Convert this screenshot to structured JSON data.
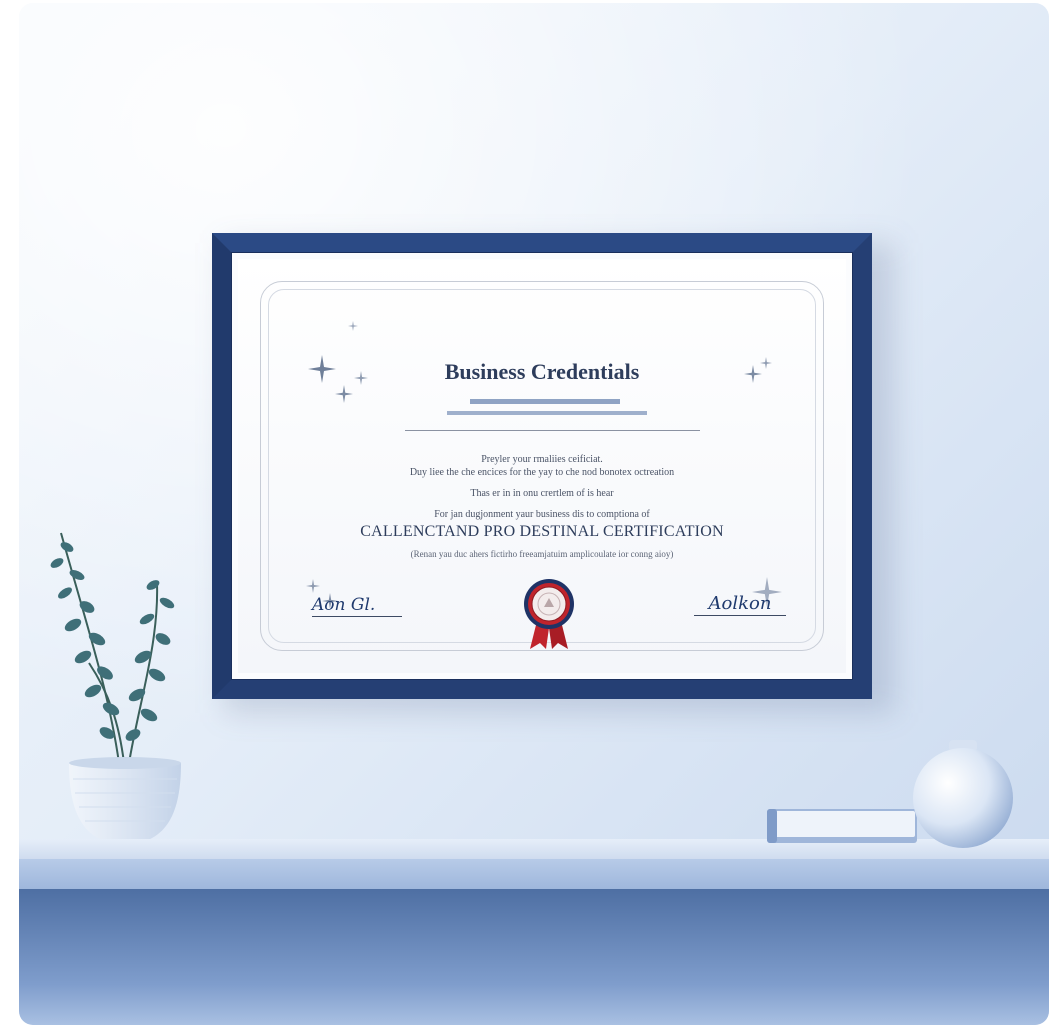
{
  "certificate": {
    "title": "Business Credentials",
    "line1": "Preyler your rmaliies ceificiat.",
    "line2": "Duy liee the che encices for the yay to che nod bonotex octreation",
    "line3": "Thas er in in onu crertlem of is hear",
    "line4": "For jan dugjonment yaur business dis to comptiona of",
    "program": "CALLENCTAND PRO DESTINAL CERTIFICATION",
    "note": "(Renan yau duc ahers fictirho freeamjatuim amplicoulate ior conng aioy)",
    "signature_left": "Aon Gl.",
    "signature_right": "Aolkon"
  },
  "colors": {
    "frame": "#253f74",
    "title_text": "#2e3d5c",
    "ribbon": "#c0242c",
    "wall": "#e4edf8",
    "floor": "#4e6fa3"
  }
}
